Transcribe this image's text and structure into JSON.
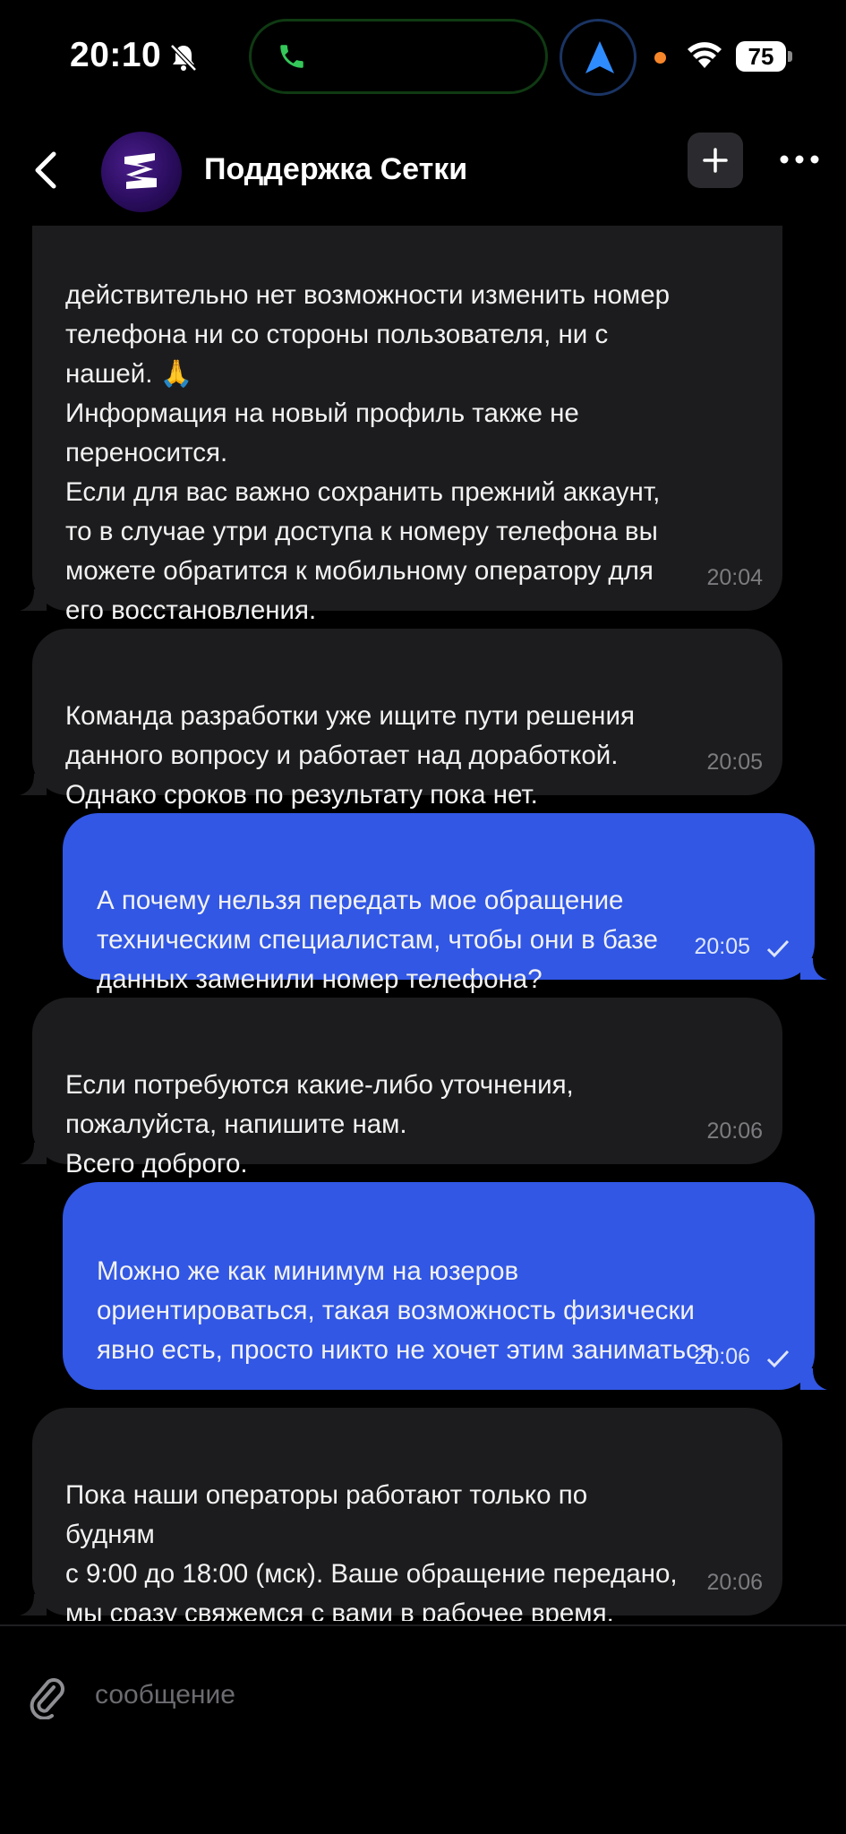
{
  "status_bar": {
    "time": "20:10",
    "battery": "75"
  },
  "header": {
    "title": "Поддержка Сетки"
  },
  "messages": [
    {
      "type": "in",
      "text": "действительно нет возможности изменить номер\nтелефона ни со стороны пользователя, ни с\nнашей. 🙏\nИнформация на новый профиль также не\nпереносится.\nЕсли для вас важно сохранить прежний аккаунт,\nто в случае утри доступа к номеру телефона вы\nможете обратится к мобильному оператору для\nего восстановления.",
      "time": "20:04"
    },
    {
      "type": "in",
      "text": "Команда разработки уже ищите пути решения\nданного вопросу и работает над доработкой.\nОднако сроков по результату пока нет.",
      "time": "20:05"
    },
    {
      "type": "out",
      "text": "А почему нельзя передать мое обращение\nтехническим специалистам, чтобы они в базе\nданных заменили номер телефона?",
      "time": "20:05"
    },
    {
      "type": "in",
      "text": "Если потребуются какие-либо уточнения,\nпожалуйста, напишите нам.\nВсего доброго.",
      "time": "20:06"
    },
    {
      "type": "out",
      "text": "Можно же как минимум на юзеров\nориентироваться, такая возможность физически\nявно есть, просто никто не хочет этим заниматься",
      "time": "20:06"
    },
    {
      "type": "in",
      "text": "Пока наши операторы работают только по будням\nс 9:00 до 18:00 (мск). Ваше обращение передано,\nмы сразу свяжемся с вами в рабочее время.",
      "time": "20:06"
    }
  ],
  "input": {
    "placeholder": "сообщение"
  },
  "colors": {
    "incoming_bubble": "#1c1c1e",
    "outgoing_bubble": "#3157e4",
    "background": "#000000"
  },
  "icons": [
    "bell-slash-icon",
    "phone-icon",
    "navigation-arrow-icon",
    "wifi-icon",
    "battery-icon",
    "back-chevron-icon",
    "plus-icon",
    "more-dots-icon",
    "paperclip-icon",
    "check-icon"
  ]
}
